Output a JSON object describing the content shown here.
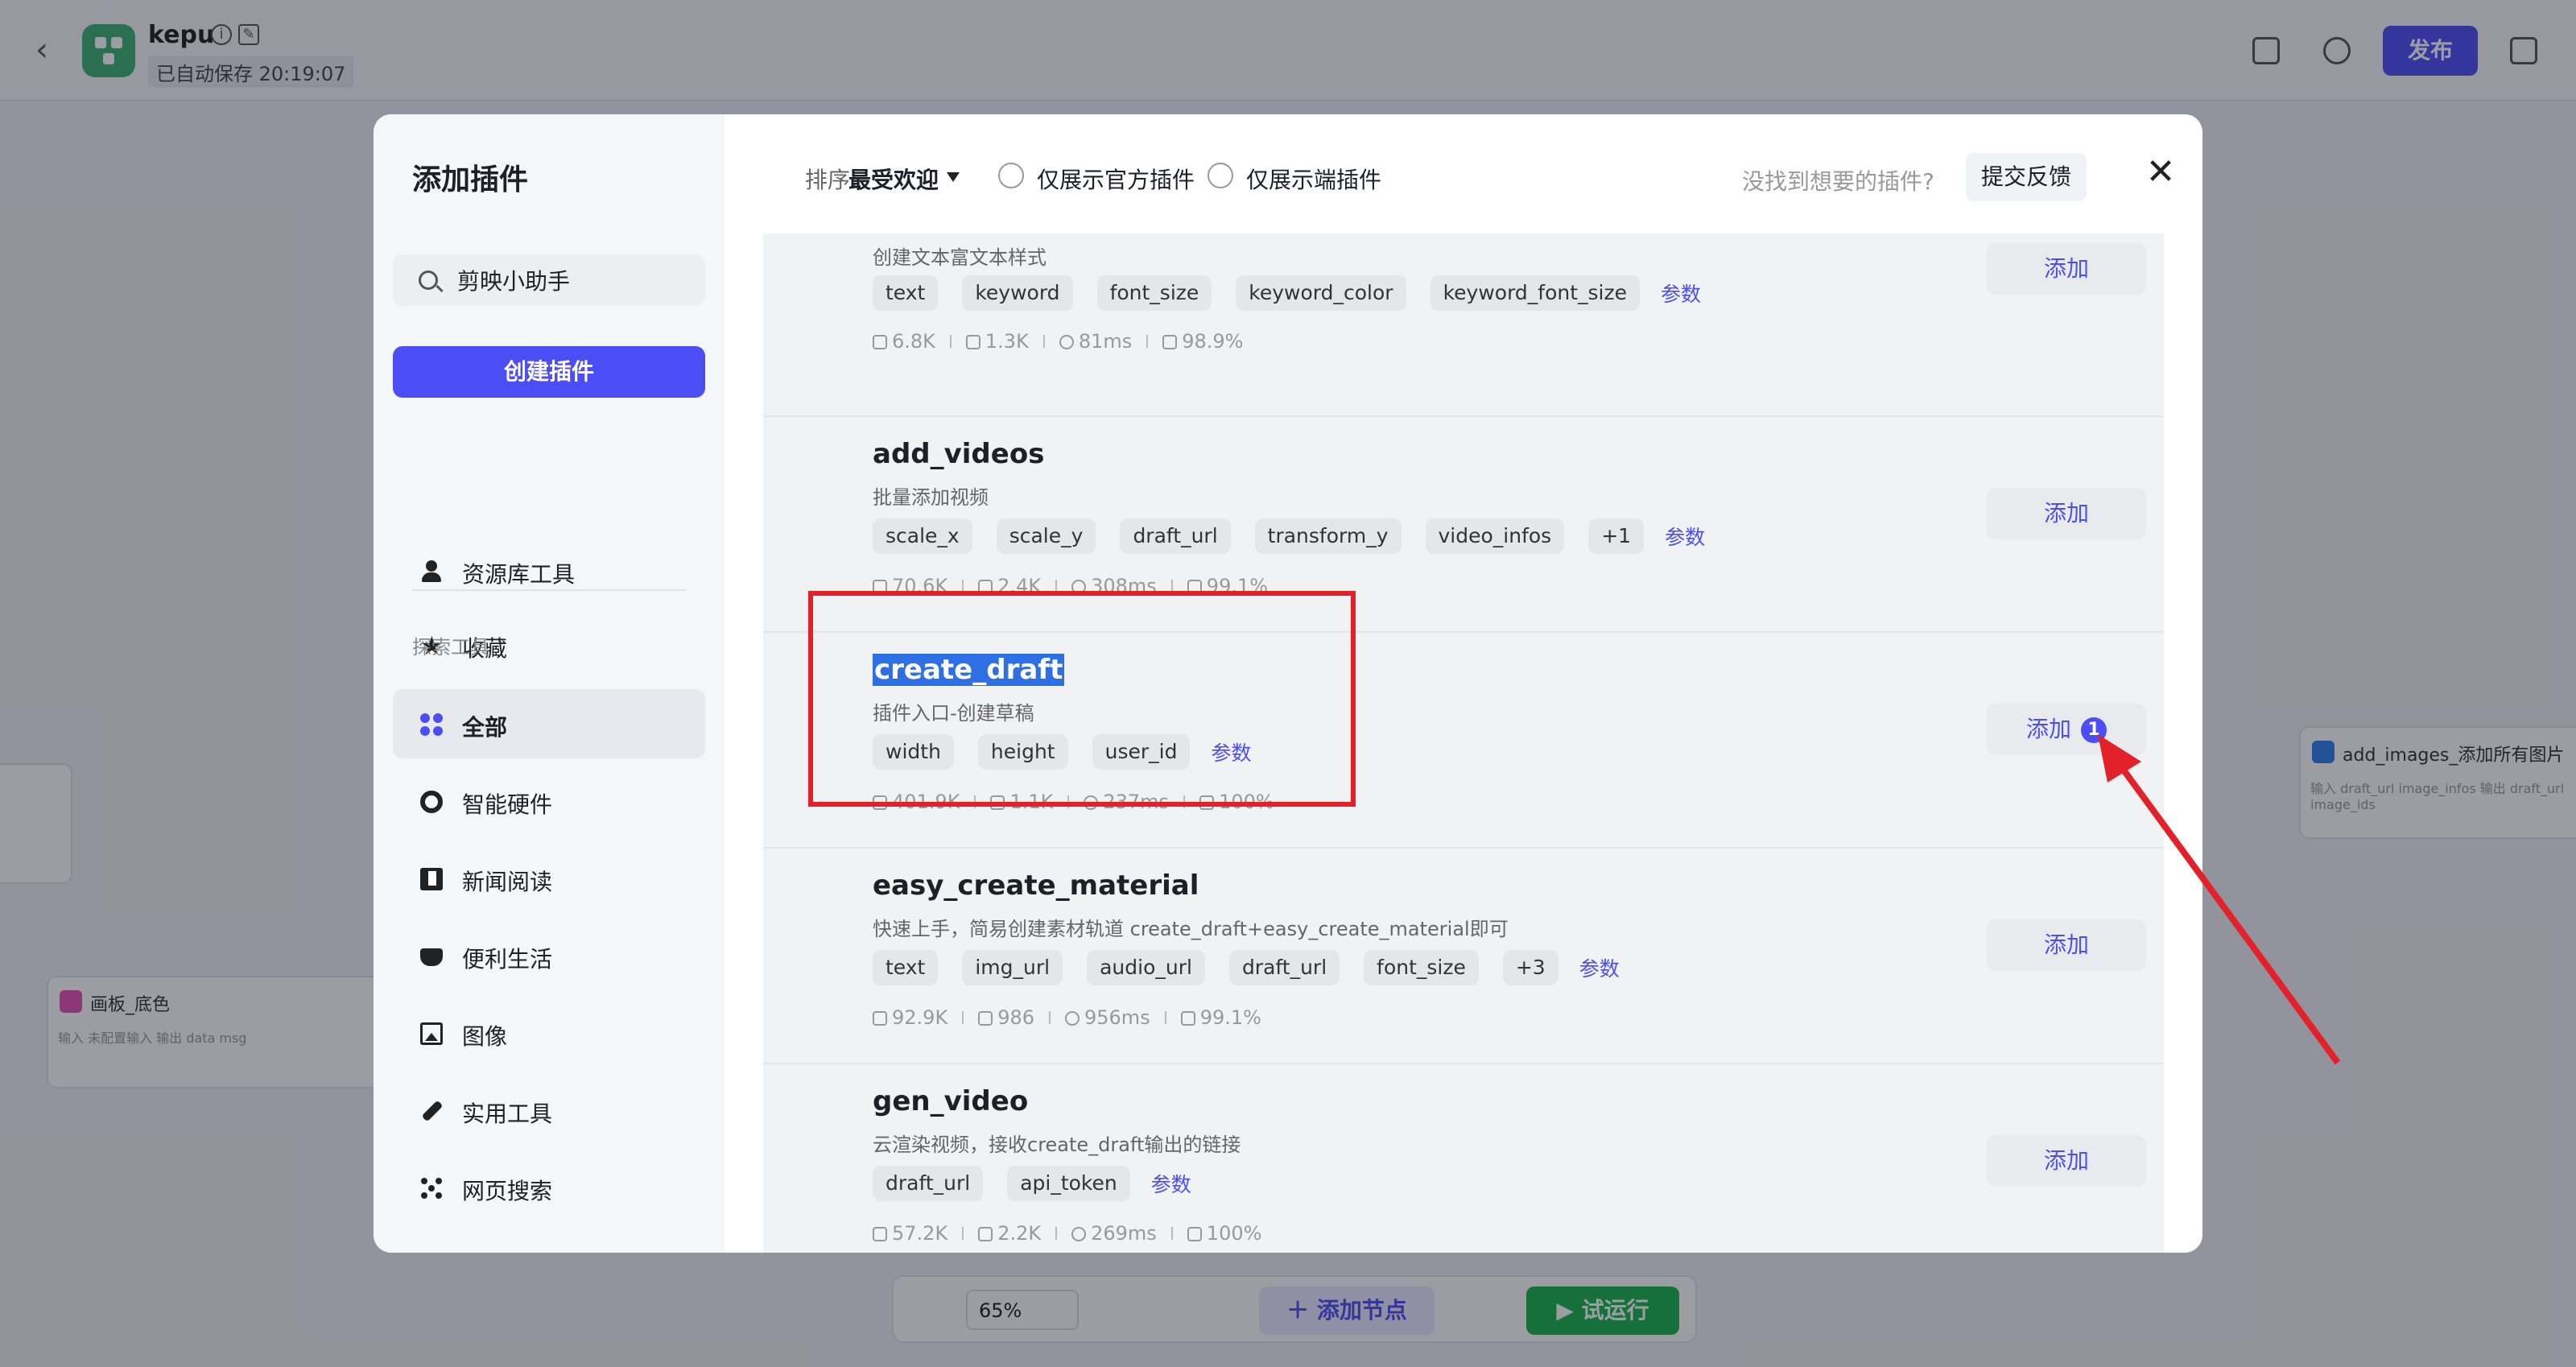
{
  "app": {
    "title": "kepu",
    "autosave": "已自动保存 20:19:07",
    "publish_label": "发布"
  },
  "canvas": {
    "node_board_title": "画板_底色",
    "node_board_sub": "输入 未配置输入  输出 data msg",
    "node_img_title": "add_images_添加所有图片",
    "node_img_sub": "输入 draft_url image_infos  输出 draft_url image_ids",
    "zoom": "65%",
    "add_node_label": "添加节点",
    "run_label": "试运行"
  },
  "modal": {
    "title": "添加插件",
    "search_value": "剪映小助手",
    "create_label": "创建插件",
    "side_items": [
      {
        "label": "资源库工具",
        "icon": "user-icon"
      },
      {
        "label": "收藏",
        "icon": "star-icon"
      }
    ],
    "section_label": "探索工具",
    "categories": [
      {
        "label": "全部",
        "icon": "grid-icon",
        "active": true
      },
      {
        "label": "智能硬件",
        "icon": "chip-icon"
      },
      {
        "label": "新闻阅读",
        "icon": "book-icon"
      },
      {
        "label": "便利生活",
        "icon": "cup-icon"
      },
      {
        "label": "图像",
        "icon": "image-icon"
      },
      {
        "label": "实用工具",
        "icon": "wrench-icon"
      },
      {
        "label": "网页搜索",
        "icon": "network-icon"
      }
    ],
    "sort_label": "排序:",
    "sort_value": "最受欢迎",
    "filter_official": "仅展示官方插件",
    "filter_cloud": "仅展示端插件",
    "feedback_question": "没找到想要的插件?",
    "feedback_label": "提交反馈",
    "add_label": "添加",
    "params_label": "参数",
    "plugins": [
      {
        "name": "",
        "desc": "创建文本富文本样式",
        "tags": [
          "text",
          "keyword",
          "font_size",
          "keyword_color",
          "keyword_font_size"
        ],
        "stats": [
          "6.8K",
          "1.3K",
          "81ms",
          "98.9%"
        ]
      },
      {
        "name": "add_videos",
        "desc": "批量添加视频",
        "tags": [
          "scale_x",
          "scale_y",
          "draft_url",
          "transform_y",
          "video_infos",
          "+1"
        ],
        "stats": [
          "70.6K",
          "2.4K",
          "308ms",
          "99.1%"
        ]
      },
      {
        "name": "create_draft",
        "desc": "插件入口-创建草稿",
        "tags": [
          "width",
          "height",
          "user_id"
        ],
        "stats": [
          "401.9K",
          "1.1K",
          "237ms",
          "100%"
        ],
        "badge": "1"
      },
      {
        "name": "easy_create_material",
        "desc": "快速上手，简易创建素材轨道 create_draft+easy_create_material即可",
        "tags": [
          "text",
          "img_url",
          "audio_url",
          "draft_url",
          "font_size",
          "+3"
        ],
        "stats": [
          "92.9K",
          "986",
          "956ms",
          "99.1%"
        ]
      },
      {
        "name": "gen_video",
        "desc": "云渲染视频，接收create_draft输出的链接",
        "tags": [
          "draft_url",
          "api_token"
        ],
        "stats": [
          "57.2K",
          "2.2K",
          "269ms",
          "100%"
        ]
      }
    ]
  },
  "colors": {
    "accent": "#4c4ef5",
    "highlight": "#e3212a",
    "run_green": "#19b34a"
  }
}
